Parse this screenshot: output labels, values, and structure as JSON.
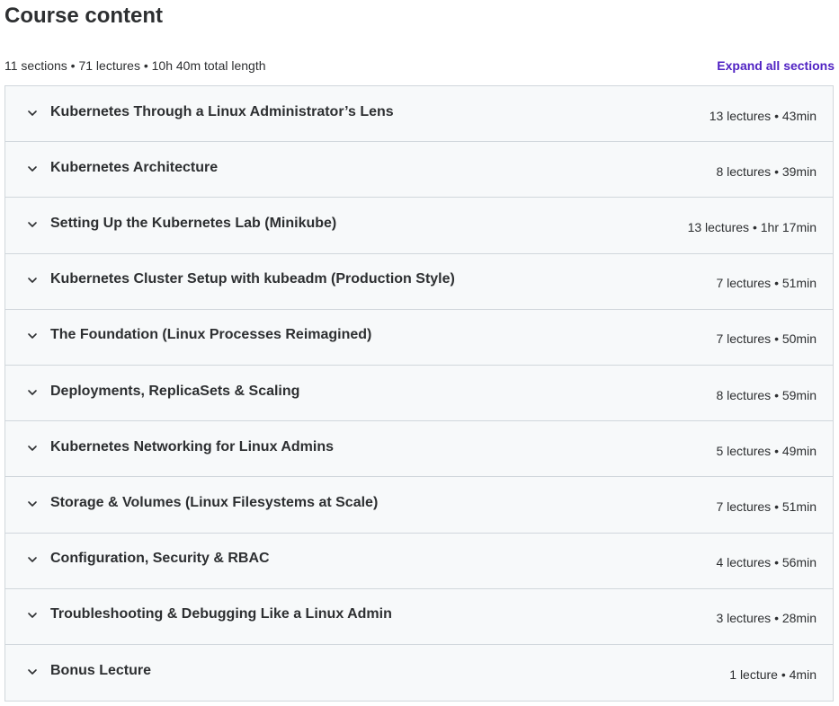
{
  "header": {
    "title": "Course content",
    "summary": "11 sections • 71 lectures • 10h 40m total length",
    "expand_label": "Expand all sections"
  },
  "sections": [
    {
      "title": "Kubernetes Through a Linux Administrator’s Lens",
      "meta": "13 lectures • 43min"
    },
    {
      "title": "Kubernetes Architecture",
      "meta": "8 lectures • 39min"
    },
    {
      "title": "Setting Up the Kubernetes Lab (Minikube)",
      "meta": "13 lectures • 1hr 17min"
    },
    {
      "title": "Kubernetes Cluster Setup with kubeadm (Production Style)",
      "meta": "7 lectures • 51min"
    },
    {
      "title": "The Foundation (Linux Processes Reimagined)",
      "meta": "7 lectures • 50min"
    },
    {
      "title": "Deployments, ReplicaSets & Scaling",
      "meta": "8 lectures • 59min"
    },
    {
      "title": "Kubernetes Networking for Linux Admins",
      "meta": "5 lectures • 49min"
    },
    {
      "title": "Storage & Volumes (Linux Filesystems at Scale)",
      "meta": "7 lectures • 51min"
    },
    {
      "title": "Configuration, Security & RBAC",
      "meta": "4 lectures • 56min"
    },
    {
      "title": "Troubleshooting & Debugging Like a Linux Admin",
      "meta": "3 lectures • 28min"
    },
    {
      "title": "Bonus Lecture",
      "meta": "1 lecture • 4min"
    }
  ],
  "icons": {
    "section_toggle": "chevron-down-icon"
  },
  "colors": {
    "accent": "#5022c3",
    "text": "#2d2f31",
    "section_bg": "#f7f9fa",
    "border": "#d1d7dc"
  }
}
